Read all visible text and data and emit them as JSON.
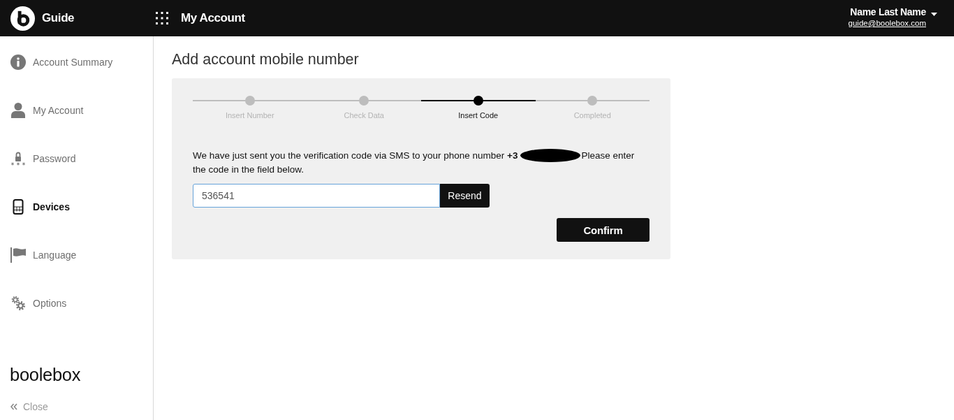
{
  "header": {
    "app_name": "Guide",
    "section_title": "My Account",
    "user": {
      "name": "Name Last Name",
      "email": "guide@boolebox.com"
    }
  },
  "sidebar": {
    "items": [
      {
        "label": "Account Summary",
        "selected": false
      },
      {
        "label": "My Account",
        "selected": false
      },
      {
        "label": "Password",
        "selected": false
      },
      {
        "label": "Devices",
        "selected": true
      },
      {
        "label": "Language",
        "selected": false
      },
      {
        "label": "Options",
        "selected": false
      }
    ],
    "brand": "boolebox",
    "close_label": "Close"
  },
  "page": {
    "title": "Add account mobile number",
    "steps": [
      {
        "label": "Insert Number",
        "selected": false
      },
      {
        "label": "Check Data",
        "selected": false
      },
      {
        "label": "Insert Code",
        "selected": true
      },
      {
        "label": "Completed",
        "selected": false
      }
    ],
    "message": {
      "before": "We have just sent you the verification code via SMS to your phone number **+3**",
      "redacted": true,
      "after": "Please enter the code in the field below."
    },
    "code_field": {
      "value": "536541"
    },
    "resend_button": "Resend",
    "confirm_button": "Confirm"
  }
}
